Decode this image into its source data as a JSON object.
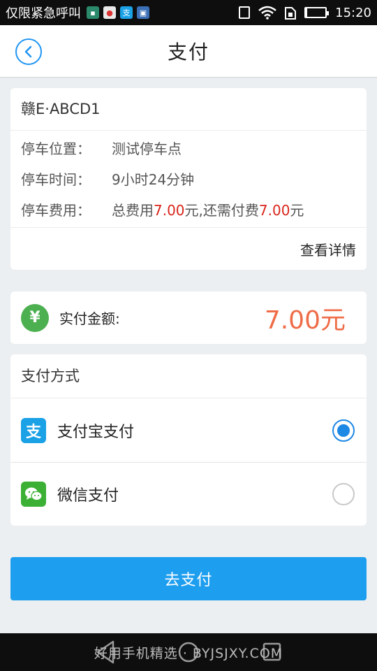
{
  "statusbar": {
    "carrier_text": "仅限紧急呼叫",
    "time": "15:20",
    "notification_icons": [
      "app-icon-green",
      "browser-icon",
      "alipay-icon",
      "gallery-icon"
    ]
  },
  "header": {
    "title": "支付"
  },
  "parking": {
    "plate": "赣E·ABCD1",
    "rows": [
      {
        "label": "停车位置：",
        "value": "测试停车点"
      },
      {
        "label": "停车时间：",
        "value": "9小时24分钟"
      }
    ],
    "fee": {
      "label": "停车费用：",
      "prefix": "总费用",
      "total": "7.00",
      "middle": "元,还需付费",
      "remaining": "7.00",
      "suffix": "元"
    },
    "details_link": "查看详情"
  },
  "amount": {
    "icon": "¥",
    "label": "实付金额:",
    "value": "7.00元"
  },
  "payment": {
    "title": "支付方式",
    "methods": [
      {
        "label": "支付宝支付",
        "icon": "支",
        "selected": true
      },
      {
        "label": "微信支付",
        "icon": "信",
        "selected": false
      }
    ]
  },
  "pay_button": "去支付",
  "footer": {
    "watermark": "好用手机精选 · BYJSJXY.COM"
  },
  "colors": {
    "accent": "#1e9eef",
    "price": "#ef6c48",
    "fee_red": "#d9261c",
    "alipay": "#1aa1e6",
    "wechat": "#3cb034"
  }
}
